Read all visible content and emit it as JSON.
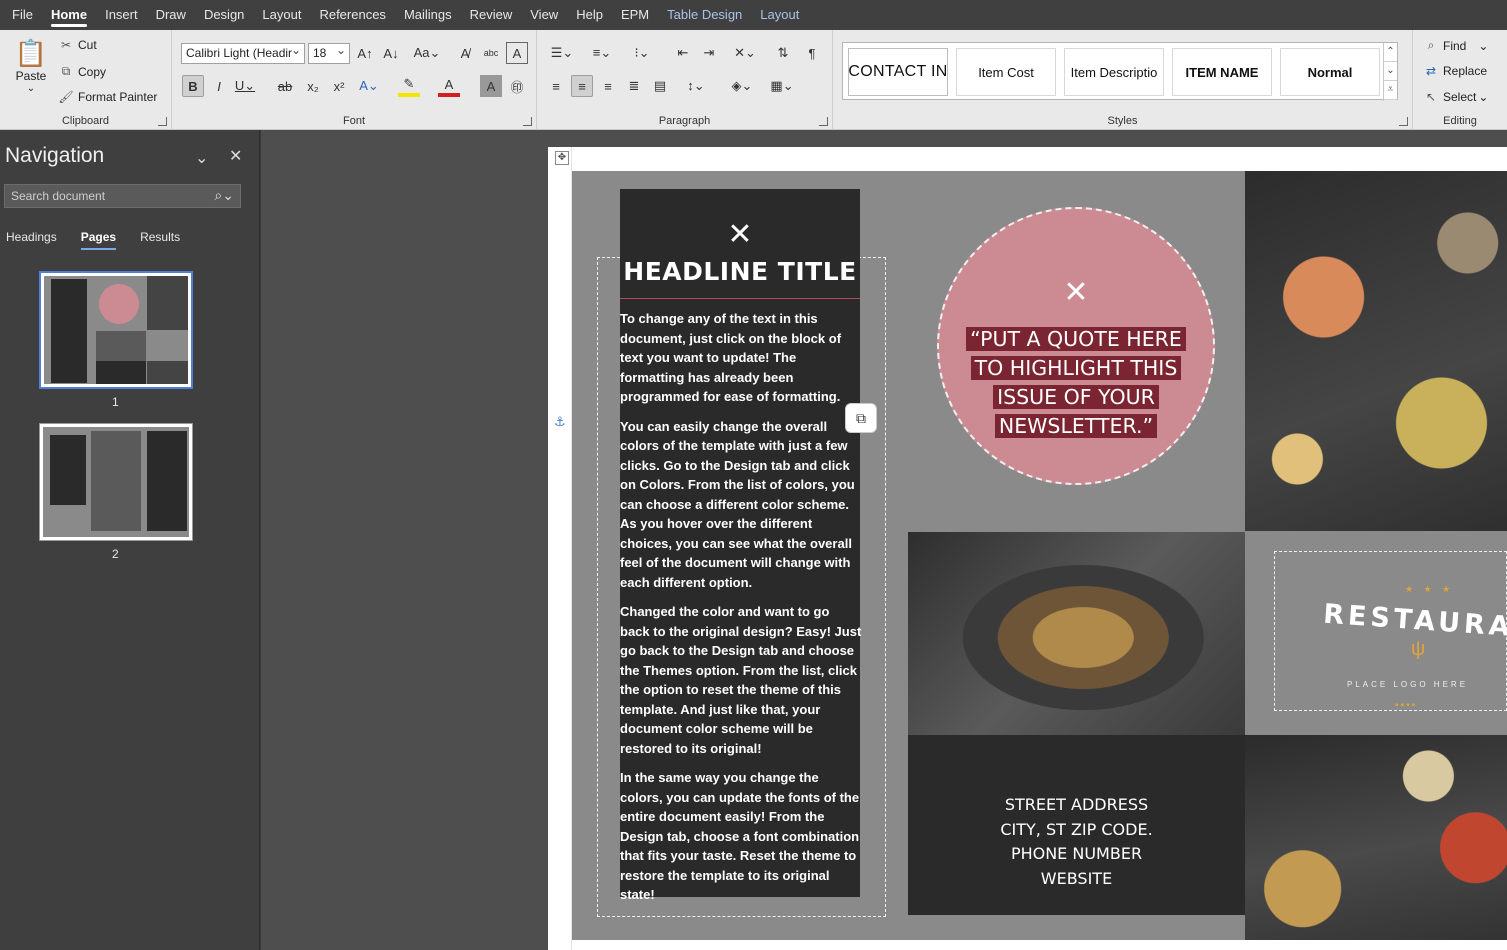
{
  "menu": {
    "tabs": [
      "File",
      "Home",
      "Insert",
      "Draw",
      "Design",
      "Layout",
      "References",
      "Mailings",
      "Review",
      "View",
      "Help",
      "EPM",
      "Table Design",
      "Layout"
    ]
  },
  "ribbon": {
    "clipboard": {
      "paste": "Paste",
      "cut": "Cut",
      "copy": "Copy",
      "format_painter": "Format Painter",
      "label": "Clipboard"
    },
    "font": {
      "name": "Calibri Light (Headir",
      "size": "18",
      "label": "Font"
    },
    "paragraph": {
      "label": "Paragraph"
    },
    "styles": {
      "items": [
        "CONTACT IN",
        "Item Cost",
        "Item Descriptio",
        "ITEM NAME",
        "Normal"
      ],
      "label": "Styles"
    },
    "editing": {
      "find": "Find",
      "replace": "Replace",
      "select": "Select",
      "label": "Editing"
    }
  },
  "navigation": {
    "title": "Navigation",
    "search_placeholder": "Search document",
    "tabs": [
      "Headings",
      "Pages",
      "Results"
    ],
    "pages": [
      "1",
      "2"
    ]
  },
  "document": {
    "headline": "HEADLINE TITLE",
    "paragraphs": [
      "To change any of the text in this document, just click on the block of text you want to update!  The formatting has already been programmed for ease of formatting.",
      "You can easily change the overall colors of the template with just a few clicks.  Go to the Design tab and click on Colors.  From the list of colors, you can choose a different color scheme.  As you hover over the different choices, you can see what the overall feel of the document will change with each different option.",
      "Changed the color and want to go back to the original design?  Easy!  Just go back to the Design tab and choose the Themes option.  From the list, click the option to reset the theme of this template.  And just like that, your document color scheme will be restored to its original!",
      "In the same way you change the colors, you can update the fonts of the entire document easily!  From the Design tab, choose a font combination that fits your taste.  Reset the theme to restore the template to its original state!"
    ],
    "quote_lines": [
      "“PUT A QUOTE HERE",
      "TO HIGHLIGHT THIS",
      "ISSUE OF YOUR",
      "NEWSLETTER.”"
    ],
    "logo": {
      "word": "RESTAURANT",
      "tagline": "PLACE LOGO HERE",
      "stars": "★ ★ ★"
    },
    "address_lines": [
      "STREET ADDRESS",
      "CITY, ST ZIP CODE.",
      "PHONE NUMBER",
      "WEBSITE"
    ]
  },
  "colors": {
    "accent_quote": "#cc8a92",
    "quote_highlight": "#7a2531",
    "dark_block": "#2a2a2a",
    "nav_accent": "#4f7fd6"
  }
}
